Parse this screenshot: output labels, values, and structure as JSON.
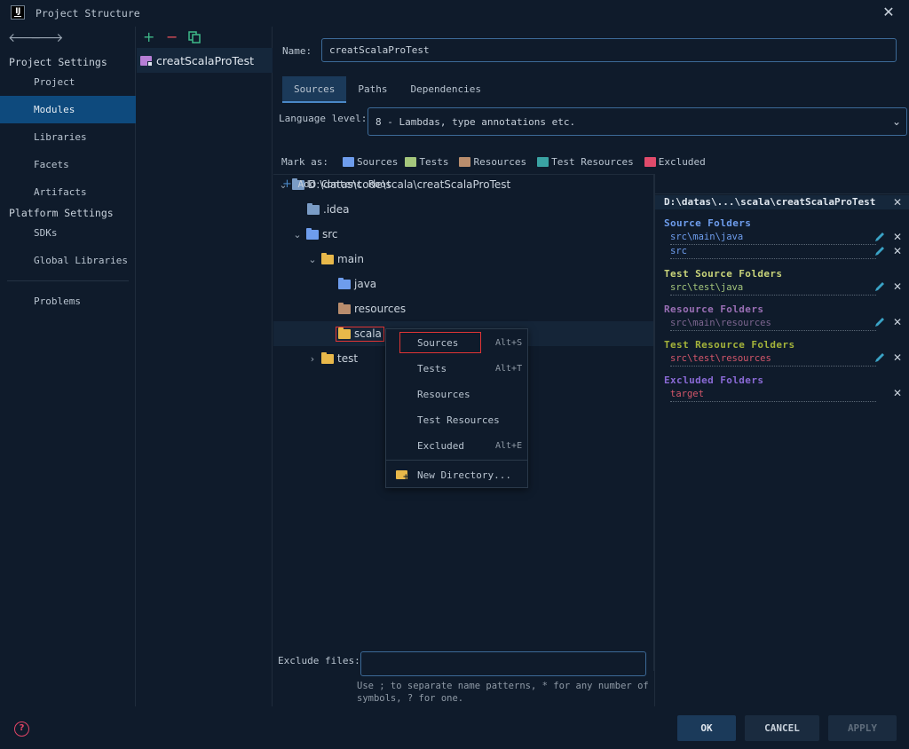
{
  "window": {
    "title": "Project Structure"
  },
  "sidebar": {
    "project_settings": "Project Settings",
    "items1": [
      {
        "label": "Project"
      },
      {
        "label": "Modules"
      },
      {
        "label": "Libraries"
      },
      {
        "label": "Facets"
      },
      {
        "label": "Artifacts"
      }
    ],
    "platform_settings": "Platform Settings",
    "items2": [
      {
        "label": "SDKs"
      },
      {
        "label": "Global Libraries"
      }
    ],
    "problems": "Problems"
  },
  "modules": {
    "selected": "creatScalaProTest"
  },
  "form": {
    "name_label": "Name:",
    "name_value": "creatScalaProTest",
    "tabs": [
      {
        "label": "Sources"
      },
      {
        "label": "Paths"
      },
      {
        "label": "Dependencies"
      }
    ],
    "language_label": "Language level:",
    "language_value": "8 - Lambdas, type annotations etc.",
    "mark_as": "Mark as:",
    "mark_buttons": [
      {
        "label": "Sources"
      },
      {
        "label": "Tests"
      },
      {
        "label": "Resources"
      },
      {
        "label": "Test Resources"
      },
      {
        "label": "Excluded"
      }
    ]
  },
  "tree": {
    "root": "D:\\datas\\code\\scala\\creatScalaProTest",
    "nodes": [
      ".idea",
      "src",
      "main",
      "java",
      "resources",
      "scala",
      "test"
    ]
  },
  "context_menu": {
    "items": [
      {
        "label": "Sources",
        "shortcut": "Alt+S"
      },
      {
        "label": "Tests",
        "shortcut": "Alt+T"
      },
      {
        "label": "Resources",
        "shortcut": ""
      },
      {
        "label": "Test Resources",
        "shortcut": ""
      },
      {
        "label": "Excluded",
        "shortcut": "Alt+E"
      }
    ],
    "new_directory": "New Directory..."
  },
  "roots": {
    "add_content_root": "Add Content Root",
    "root_path": "D:\\datas\\...\\scala\\creatScalaProTest",
    "source_folders": {
      "title": "Source Folders",
      "items": [
        "src\\main\\java",
        "src"
      ]
    },
    "test_source_folders": {
      "title": "Test Source Folders",
      "items": [
        "src\\test\\java"
      ]
    },
    "resource_folders": {
      "title": "Resource Folders",
      "items": [
        "src\\main\\resources"
      ]
    },
    "test_resource_folders": {
      "title": "Test Resource Folders",
      "items": [
        "src\\test\\resources"
      ]
    },
    "excluded_folders": {
      "title": "Excluded Folders",
      "items": [
        "target"
      ]
    }
  },
  "exclude": {
    "label": "Exclude files:",
    "hint": "Use ; to separate name patterns, * for any number of symbols, ? for one."
  },
  "buttons": {
    "ok": "OK",
    "cancel": "CANCEL",
    "apply": "APPLY"
  },
  "colors": {
    "accent": "#0e4a7d",
    "sources": "#6e9ded",
    "tests": "#a4c67c",
    "resources": "#b98d6d",
    "test_resources": "#3aa3a3",
    "excluded": "#e04b6b",
    "highlight_box": "#e03535"
  }
}
